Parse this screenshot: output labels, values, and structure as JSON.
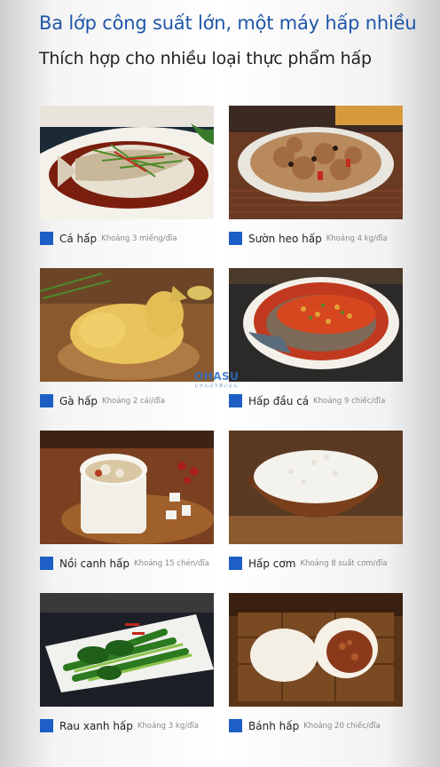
{
  "header": {
    "title": "Ba lớp công suất lớn, một máy hấp nhiều",
    "subtitle": "Thích hợp cho nhiều loại thực phẩm hấp"
  },
  "foods": [
    {
      "name": "Cá hấp",
      "quantity": "Khoảng 3 miếng/đĩa"
    },
    {
      "name": "Sườn heo hấp",
      "quantity": "Khoảng 4 kg/đĩa"
    },
    {
      "name": "Gà hấp",
      "quantity": "Khoảng 2 cái/đĩa"
    },
    {
      "name": "Hấp đầu cá",
      "quantity": "Khoảng 9 chiếc/đĩa"
    },
    {
      "name": "Nồi canh hấp",
      "quantity": "Khoảng 15 chén/đĩa"
    },
    {
      "name": "Hấp cơm",
      "quantity": "Khoảng 8 suất cơm/đĩa"
    },
    {
      "name": "Rau xanh hấp",
      "quantity": "Khoảng 3 kg/đĩa"
    },
    {
      "name": "Bánh hấp",
      "quantity": "Khoảng 20 chiếc/đĩa"
    }
  ],
  "watermark": {
    "brand": "OHASU",
    "tagline": "じゃんぷうまいよん"
  },
  "colors": {
    "accent": "#1d5fc4",
    "title": "#1f56a8"
  }
}
